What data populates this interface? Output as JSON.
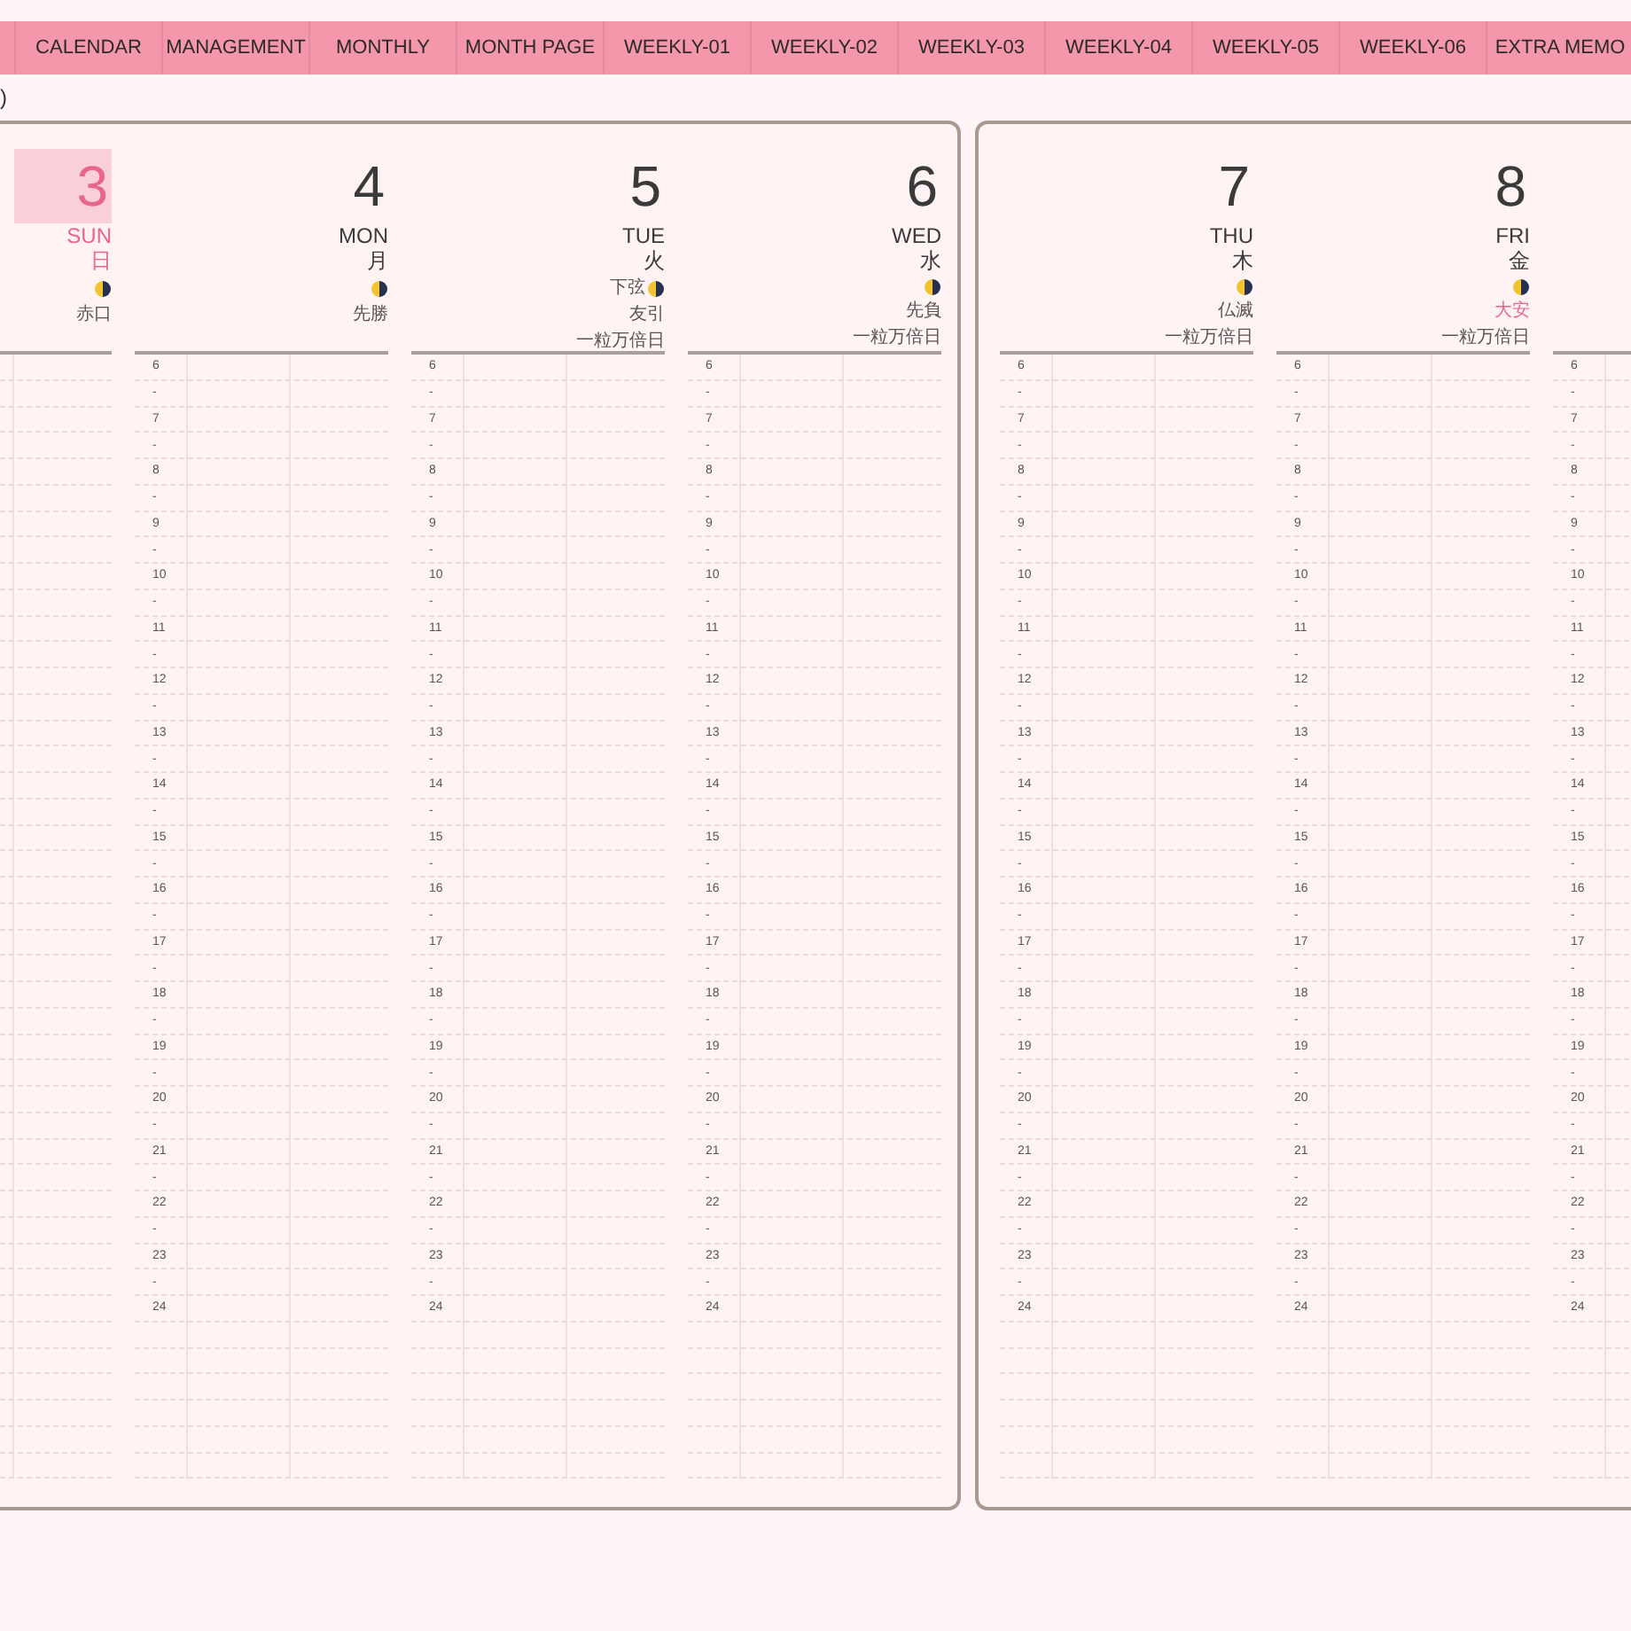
{
  "tabs": [
    {
      "label": "CALENDAR",
      "selected": false
    },
    {
      "label": "MANAGEMENT",
      "selected": false
    },
    {
      "label": "MONTHLY",
      "selected": false
    },
    {
      "label": "MONTH PAGE",
      "selected": false
    },
    {
      "label": "WEEKLY-01",
      "selected": false
    },
    {
      "label": "WEEKLY-02",
      "selected": false
    },
    {
      "label": "WEEKLY-03",
      "selected": false
    },
    {
      "label": "WEEKLY-04",
      "selected": false
    },
    {
      "label": "WEEKLY-05",
      "selected": false
    },
    {
      "label": "WEEKLY-06",
      "selected": false
    },
    {
      "label": "EXTRA MEMO",
      "selected": false
    }
  ],
  "note": ")",
  "pages": [
    {
      "days": [
        {
          "number": "3",
          "weekday": "SUN",
          "kanji": "日",
          "highlighted": true,
          "holiday": true,
          "rokuyo": {
            "text": "赤口",
            "lucky": false
          }
        },
        {
          "number": "4",
          "weekday": "MON",
          "kanji": "月",
          "highlighted": false,
          "holiday": false,
          "rokuyo": {
            "text": "先勝",
            "lucky": false
          },
          "hours": [
            "6",
            "-",
            "7",
            "-",
            "8",
            "-",
            "9",
            "-",
            "10",
            "-",
            "11",
            "-",
            "12",
            "-",
            "13",
            "-",
            "14",
            "-",
            "15",
            "-",
            "16",
            "-",
            "17",
            "-",
            "18",
            "-",
            "19",
            "-",
            "20",
            "-",
            "21",
            "-",
            "22",
            "-",
            "23",
            "-",
            "24"
          ]
        },
        {
          "number": "5",
          "weekday": "TUE",
          "kanji": "火",
          "highlighted": false,
          "holiday": false,
          "moon_note": "下弦",
          "rokuyo": {
            "text": "友引",
            "lucky": false
          },
          "special": "一粒万倍日",
          "hours": [
            "6",
            "-",
            "7",
            "-",
            "8",
            "-",
            "9",
            "-",
            "10",
            "-",
            "11",
            "-",
            "12",
            "-",
            "13",
            "-",
            "14",
            "-",
            "15",
            "-",
            "16",
            "-",
            "17",
            "-",
            "18",
            "-",
            "19",
            "-",
            "20",
            "-",
            "21",
            "-",
            "22",
            "-",
            "23",
            "-",
            "24"
          ]
        },
        {
          "number": "6",
          "weekday": "WED",
          "kanji": "水",
          "highlighted": false,
          "holiday": false,
          "rokuyo": {
            "text": "先負",
            "lucky": false
          },
          "special": "一粒万倍日",
          "hours": [
            "6",
            "-",
            "7",
            "-",
            "8",
            "-",
            "9",
            "-",
            "10",
            "-",
            "11",
            "-",
            "12",
            "-",
            "13",
            "-",
            "14",
            "-",
            "15",
            "-",
            "16",
            "-",
            "17",
            "-",
            "18",
            "-",
            "19",
            "-",
            "20",
            "-",
            "21",
            "-",
            "22",
            "-",
            "23",
            "-",
            "24"
          ]
        }
      ]
    },
    {
      "days": [
        {
          "number": "7",
          "weekday": "THU",
          "kanji": "木",
          "highlighted": false,
          "holiday": false,
          "rokuyo": {
            "text": "仏滅",
            "lucky": false
          },
          "special": "一粒万倍日",
          "hours": [
            "6",
            "-",
            "7",
            "-",
            "8",
            "-",
            "9",
            "-",
            "10",
            "-",
            "11",
            "-",
            "12",
            "-",
            "13",
            "-",
            "14",
            "-",
            "15",
            "-",
            "16",
            "-",
            "17",
            "-",
            "18",
            "-",
            "19",
            "-",
            "20",
            "-",
            "21",
            "-",
            "22",
            "-",
            "23",
            "-",
            "24"
          ]
        },
        {
          "number": "8",
          "weekday": "FRI",
          "kanji": "金",
          "highlighted": false,
          "holiday": false,
          "rokuyo": {
            "text": "大安",
            "lucky": true
          },
          "special": "一粒万倍日",
          "hours": [
            "6",
            "-",
            "7",
            "-",
            "8",
            "-",
            "9",
            "-",
            "10",
            "-",
            "11",
            "-",
            "12",
            "-",
            "13",
            "-",
            "14",
            "-",
            "15",
            "-",
            "16",
            "-",
            "17",
            "-",
            "18",
            "-",
            "19",
            "-",
            "20",
            "-",
            "21",
            "-",
            "22",
            "-",
            "23",
            "-",
            "24"
          ]
        },
        {
          "hours": [
            "6",
            "-",
            "7",
            "-",
            "8",
            "-",
            "9",
            "-",
            "10",
            "-",
            "11",
            "-",
            "12",
            "-",
            "13",
            "-",
            "14",
            "-",
            "15",
            "-",
            "16",
            "-",
            "17",
            "-",
            "18",
            "-",
            "19",
            "-",
            "20",
            "-",
            "21",
            "-",
            "22",
            "-",
            "23",
            "-",
            "24"
          ]
        }
      ]
    }
  ]
}
